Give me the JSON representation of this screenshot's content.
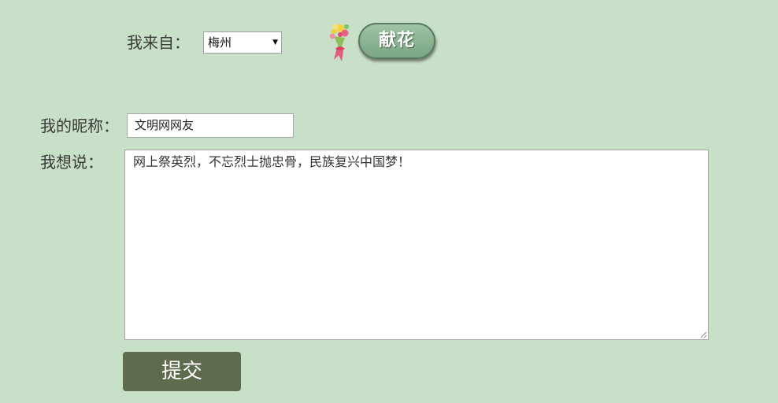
{
  "form": {
    "from_label": "我来自：",
    "city_select": {
      "selected": "梅州"
    },
    "nickname_label": "我的昵称：",
    "nickname_value": "文明网网友",
    "message_label": "我想说：",
    "message_value": "网上祭英烈，不忘烈士抛忠骨，民族复兴中国梦！",
    "submit_label": "提交"
  },
  "gift": {
    "button_label": "献花",
    "icon": "flower-bouquet-icon"
  },
  "colors": {
    "background": "#c8dfc8",
    "gift_button": "#8db895",
    "submit_button": "#5e6b4c"
  }
}
